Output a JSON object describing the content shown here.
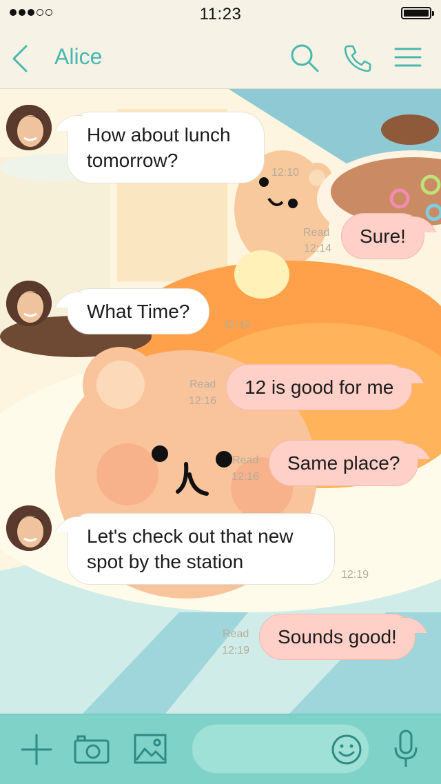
{
  "status_bar": {
    "time": "11:23",
    "signal_bars": 3,
    "signal_total": 5
  },
  "header": {
    "title": "Alice",
    "icons": [
      "back-icon",
      "search-icon",
      "phone-icon",
      "menu-icon"
    ],
    "accent_color": "#49b7ae"
  },
  "messages": [
    {
      "direction": "in",
      "text_lines": [
        "How about lunch",
        "tomorrow?"
      ],
      "time": "12:10"
    },
    {
      "direction": "out",
      "text": "Sure!",
      "read": "Read",
      "time": "12:14"
    },
    {
      "direction": "in",
      "text": "What Time?",
      "time": "12:14"
    },
    {
      "direction": "out",
      "text": "12 is good for me",
      "read": "Read",
      "time": "12:16"
    },
    {
      "direction": "out",
      "text": "Same place?",
      "read": "Read",
      "time": "12:16"
    },
    {
      "direction": "in",
      "text_lines": [
        "Let's check out that new",
        "spot by the station"
      ],
      "time": "12:19"
    },
    {
      "direction": "out",
      "text": "Sounds good!",
      "read": "Read",
      "time": "12:19"
    }
  ],
  "toolbar": {
    "icons": [
      "plus-icon",
      "camera-icon",
      "gallery-icon",
      "emoji-icon",
      "mic-icon"
    ],
    "input_value": "",
    "bar_color": "#7fd2c7"
  },
  "colors": {
    "incoming_bubble": "#ffffff",
    "outgoing_bubble": "#ffd0c8",
    "meta_text": "#b5ac9c"
  }
}
